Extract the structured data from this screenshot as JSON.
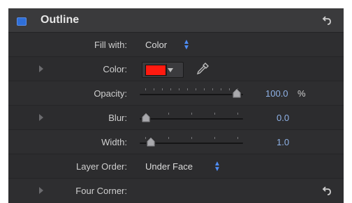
{
  "panel": {
    "title": "Outline",
    "enabled": true,
    "accent_color": "#2f6fd8"
  },
  "rows": {
    "fill_with": {
      "label": "Fill with:",
      "value": "Color"
    },
    "color": {
      "label": "Color:",
      "swatch_color": "#ff1a10"
    },
    "opacity": {
      "label": "Opacity:",
      "value_text": "100.0",
      "unit": "%",
      "level": 1.0
    },
    "blur": {
      "label": "Blur:",
      "value_text": "0.0",
      "level": 0.0
    },
    "width": {
      "label": "Width:",
      "value_text": "1.0",
      "level": 0.05
    },
    "layer_order": {
      "label": "Layer Order:",
      "value": "Under Face"
    },
    "four_corner": {
      "label": "Four Corner:"
    }
  },
  "icons": {
    "reset": "reset-arrow-icon",
    "disclosure": "disclosure-triangle-icon",
    "eyedropper": "eyedropper-icon",
    "stepper": "up-down-stepper-icon"
  }
}
